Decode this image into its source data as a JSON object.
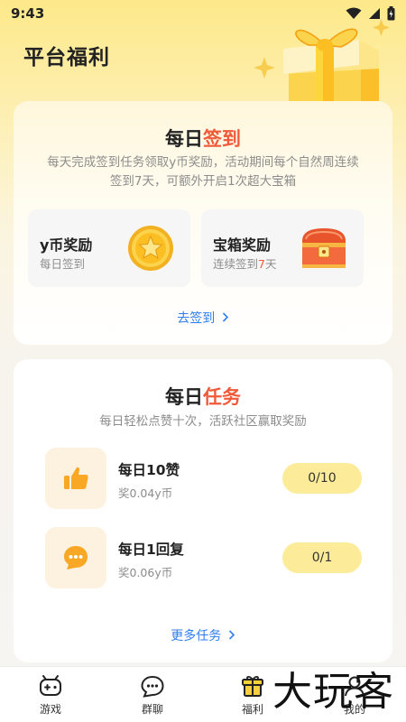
{
  "status": {
    "time": "9:43"
  },
  "page_title": "平台福利",
  "signin": {
    "title_prefix": "每日",
    "title_accent": "签到",
    "desc_line1": "每天完成签到任务领取y币奖励，活动期间每个自然周连续",
    "desc_line2": "签到7天，可额外开启1次超大宝箱",
    "rewards": [
      {
        "name": "y币奖励",
        "sub_prefix": "每日签到",
        "sub_accent": "",
        "sub_suffix": "",
        "icon": "coin-icon"
      },
      {
        "name": "宝箱奖励",
        "sub_prefix": "连续签到",
        "sub_accent": "7",
        "sub_suffix": "天",
        "icon": "treasure-chest-icon"
      }
    ],
    "action_label": "去签到"
  },
  "tasks": {
    "title_prefix": "每日",
    "title_accent": "任务",
    "desc": "每日轻松点赞十次，活跃社区赢取奖励",
    "items": [
      {
        "name": "每日10赞",
        "reward": "奖0.04y币",
        "progress": "0/10",
        "icon": "thumbs-up-icon"
      },
      {
        "name": "每日1回复",
        "reward": "奖0.06y币",
        "progress": "0/1",
        "icon": "chat-bubble-icon"
      }
    ],
    "more_label": "更多任务"
  },
  "nav": {
    "items": [
      {
        "label": "游戏",
        "icon": "gamepad-icon"
      },
      {
        "label": "群聊",
        "icon": "chat-icon"
      },
      {
        "label": "福利",
        "icon": "gift-icon"
      },
      {
        "label": "我的",
        "icon": "user-icon"
      }
    ]
  },
  "watermark": "大玩客",
  "colors": {
    "accent_red": "#f05a3a",
    "link_blue": "#2f7ef0",
    "progress_yellow": "#fcec9a"
  }
}
